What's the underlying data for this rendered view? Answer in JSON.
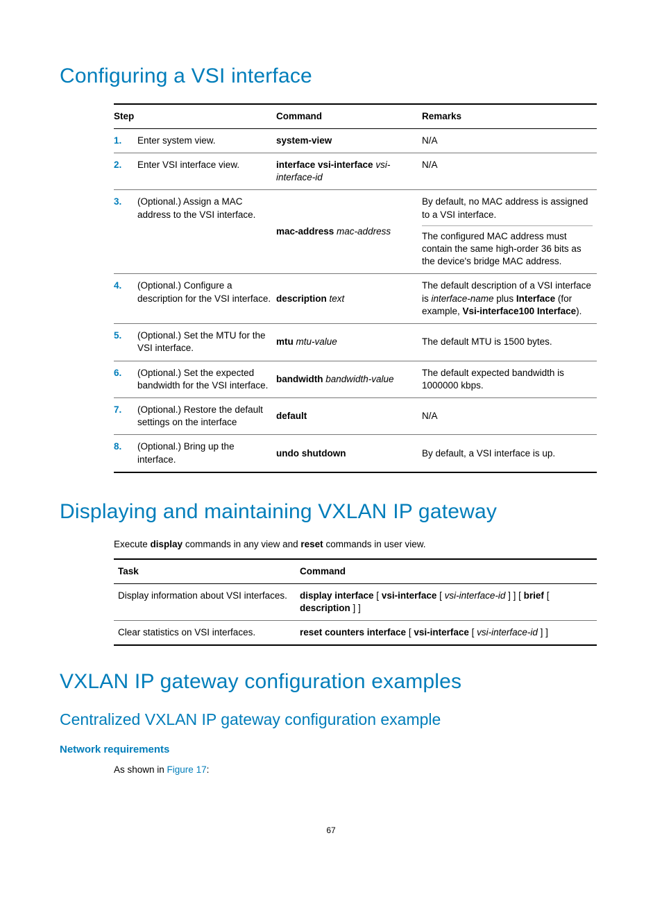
{
  "heading1": "Configuring a VSI interface",
  "table1": {
    "headers": {
      "step": "Step",
      "command": "Command",
      "remarks": "Remarks"
    },
    "rows": [
      {
        "num": "1.",
        "step": "Enter system view.",
        "cmd_b": "system-view",
        "cmd_i": "",
        "remarks": "N/A"
      },
      {
        "num": "2.",
        "step": "Enter VSI interface view.",
        "cmd_b": "interface vsi-interface",
        "cmd_i": "vsi-interface-id",
        "remarks": "N/A"
      },
      {
        "num": "3.",
        "step": "(Optional.) Assign a MAC address to the VSI interface.",
        "cmd_b": "mac-address",
        "cmd_i": " mac-address",
        "remarks_top": "By default, no MAC address is assigned to a VSI interface.",
        "remarks_bot": "The configured MAC address must contain the same high-order 36 bits as the device's bridge MAC address."
      },
      {
        "num": "4.",
        "step": "(Optional.) Configure a description for the VSI interface.",
        "cmd_b": "description",
        "cmd_i": " text",
        "remarks_pre": "The default description of a VSI interface is ",
        "remarks_i1": "interface-name",
        "remarks_mid1": " plus ",
        "remarks_b1": "Interface",
        "remarks_mid2": " (for example, ",
        "remarks_b2": "Vsi-interface100 Interface",
        "remarks_post": ")."
      },
      {
        "num": "5.",
        "step": "(Optional.) Set the MTU for the VSI interface.",
        "cmd_b": "mtu",
        "cmd_i": " mtu-value",
        "remarks": "The default MTU is 1500 bytes."
      },
      {
        "num": "6.",
        "step": "(Optional.) Set the expected bandwidth for the VSI interface.",
        "cmd_b": "bandwidth",
        "cmd_i": " bandwidth-value",
        "remarks": "The default expected bandwidth is 1000000 kbps."
      },
      {
        "num": "7.",
        "step": "(Optional.) Restore the default settings on the interface",
        "cmd_b": "default",
        "cmd_i": "",
        "remarks": "N/A"
      },
      {
        "num": "8.",
        "step": "(Optional.) Bring up the interface.",
        "cmd_b": "undo shutdown",
        "cmd_i": "",
        "remarks": "By default, a VSI interface is up."
      }
    ]
  },
  "heading2": "Displaying and maintaining VXLAN IP gateway",
  "para2_pre": "Execute ",
  "para2_b1": "display",
  "para2_mid": " commands in any view and ",
  "para2_b2": "reset",
  "para2_post": " commands in user view.",
  "table2": {
    "headers": {
      "task": "Task",
      "command": "Command"
    },
    "rows": [
      {
        "task": "Display information about VSI interfaces.",
        "c1": "display interface",
        "c2": " [ ",
        "c3": "vsi-interface",
        "c4": " [ ",
        "c5": "vsi-interface-id",
        "c6": " ] ] [ ",
        "c7": "brief",
        "c8": " [ ",
        "c9": "description",
        "c10": " ] ]"
      },
      {
        "task": "Clear statistics on VSI interfaces.",
        "c1": "reset counters interface",
        "c2": " [ ",
        "c3": "vsi-interface",
        "c4": " [ ",
        "c5": "vsi-interface-id",
        "c6": " ] ]"
      }
    ]
  },
  "heading3": "VXLAN IP gateway configuration examples",
  "heading4": "Centralized VXLAN IP gateway configuration example",
  "heading5": "Network requirements",
  "para5_pre": "As shown in ",
  "para5_link": "Figure 17",
  "para5_post": ":",
  "pageNumber": "67"
}
